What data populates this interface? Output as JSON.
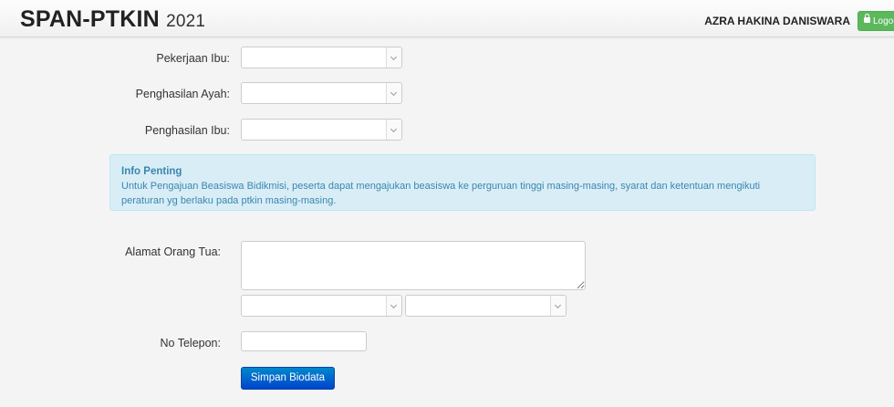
{
  "header": {
    "brand": "SPAN-PTKIN",
    "year": "2021",
    "user_name": "AZRA HAKINA DANISWARA",
    "logout_label": "Logout"
  },
  "form": {
    "pekerjaan_ibu_label": "Pekerjaan Ibu:",
    "penghasilan_ayah_label": "Penghasilan Ayah:",
    "penghasilan_ibu_label": "Penghasilan Ibu:",
    "alamat_label": "Alamat Orang Tua:",
    "telepon_label": "No Telepon:",
    "submit_label": "Simpan Biodata"
  },
  "info": {
    "title": "Info Penting",
    "body": "Untuk Pengajuan Beasiswa Bidikmisi, peserta dapat mengajukan beasiswa ke perguruan tinggi masing-masing, syarat dan ketentuan mengikuti peraturan yg berlaku pada ptkin masing-masing."
  },
  "colors": {
    "primary": "#0055cc",
    "success": "#5cb85c",
    "info_bg": "#d9edf7",
    "info_text": "#3a87ad"
  }
}
